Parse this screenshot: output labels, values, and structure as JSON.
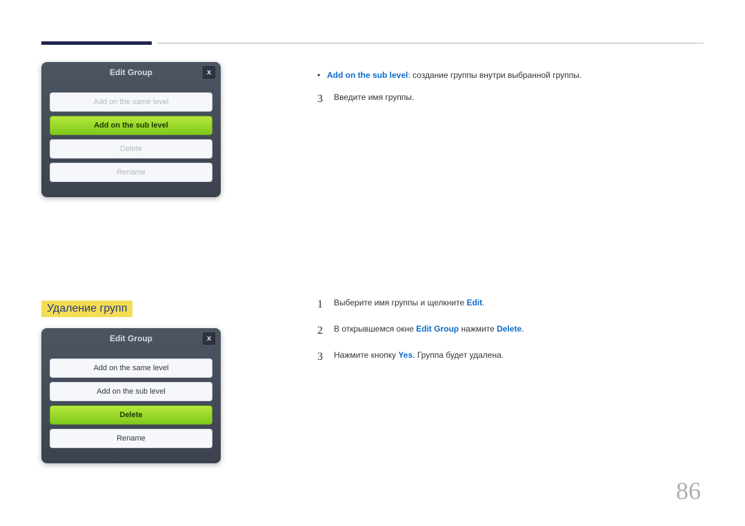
{
  "page_number": "86",
  "dialog1": {
    "title": "Edit Group",
    "close_glyph": "x",
    "buttons": {
      "same": "Add on the same level",
      "sub": "Add on the sub level",
      "delete": "Delete",
      "rename": "Rename"
    }
  },
  "section1": {
    "bullet": {
      "term": "Add on the sub level",
      "rest": ": создание группы внутри выбранной группы."
    },
    "step3_num": "3",
    "step3_text": "Введите имя группы."
  },
  "section2_heading": "Удаление групп",
  "dialog2": {
    "title": "Edit Group",
    "close_glyph": "x",
    "buttons": {
      "same": "Add on the same level",
      "sub": "Add on the sub level",
      "delete": "Delete",
      "rename": "Rename"
    }
  },
  "section2": {
    "step1_num": "1",
    "step1_a": "Выберите имя группы и щелкните ",
    "step1_b": "Edit",
    "step1_c": ".",
    "step2_num": "2",
    "step2_a": "В открывшемся окне ",
    "step2_b": "Edit Group",
    "step2_c": " нажмите ",
    "step2_d": "Delete",
    "step2_e": ".",
    "step3_num": "3",
    "step3_a": "Нажмите кнопку ",
    "step3_b": "Yes",
    "step3_c": ". Группа будет удалена."
  }
}
